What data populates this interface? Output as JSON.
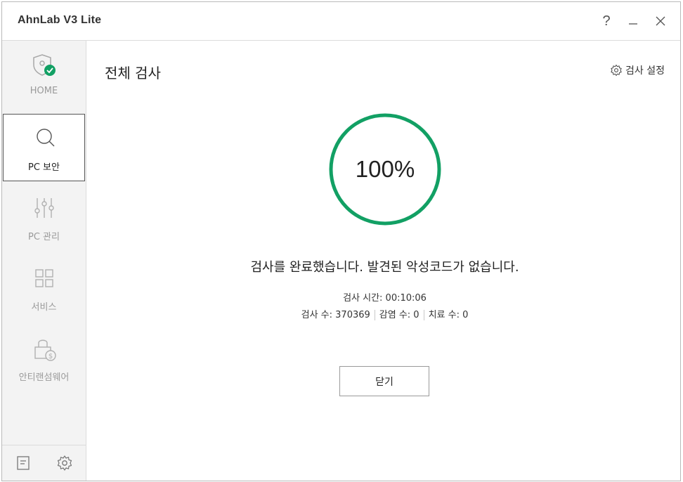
{
  "window": {
    "title": "AhnLab V3 Lite",
    "help_label": "?"
  },
  "sidebar": {
    "items": [
      {
        "label": "HOME",
        "icon": "shield-check-icon"
      },
      {
        "label": "PC 보안",
        "icon": "search-icon"
      },
      {
        "label": "PC 관리",
        "icon": "sliders-icon"
      },
      {
        "label": "서비스",
        "icon": "grid-icon"
      },
      {
        "label": "안티랜섬웨어",
        "icon": "lock-dollar-icon"
      }
    ],
    "active_index": 1,
    "bottom_icons": [
      "notes-icon",
      "gear-icon"
    ]
  },
  "main": {
    "title": "전체 검사",
    "settings_label": "검사 설정",
    "progress_label": "100%",
    "progress_value": 1.0,
    "result_message": "검사를 완료했습니다. 발견된 악성코드가 없습니다.",
    "scan_time": "검사 시간: 00:10:06",
    "stats": {
      "scanned": "검사 수: 370369",
      "infected": "감염 수: 0",
      "treated": "치료 수: 0"
    },
    "close_button_label": "닫기"
  },
  "colors": {
    "accent_green": "#12a064",
    "sidebar_bg": "#f3f3f3",
    "inactive_text": "#9a9a9a"
  }
}
